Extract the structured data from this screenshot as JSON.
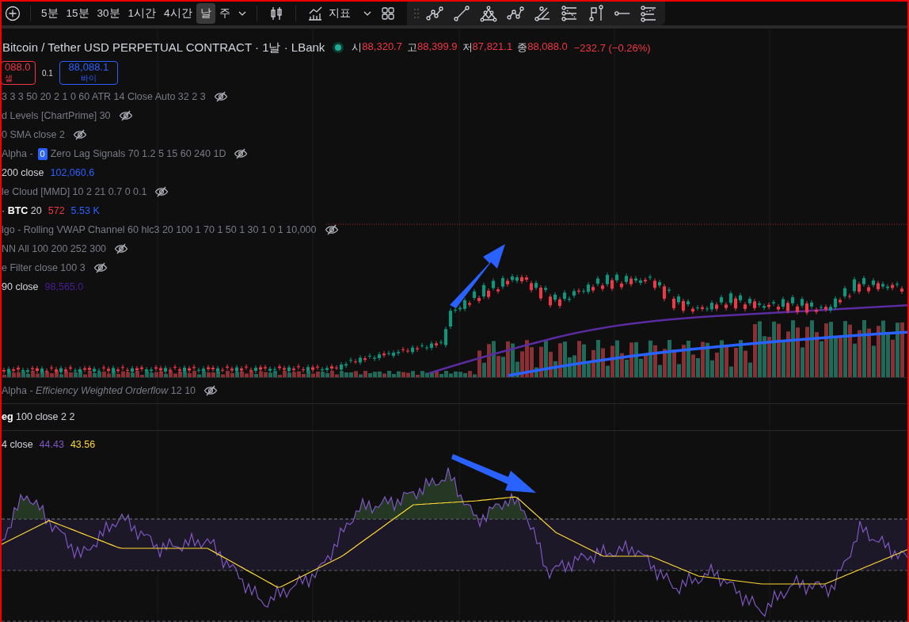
{
  "toolbar": {
    "intervals": [
      {
        "label": "5분",
        "selected": false
      },
      {
        "label": "15분",
        "selected": false
      },
      {
        "label": "30분",
        "selected": false
      },
      {
        "label": "1시간",
        "selected": false
      },
      {
        "label": "4시간",
        "selected": false
      },
      {
        "label": "날",
        "selected": true
      },
      {
        "label": "주",
        "selected": false
      }
    ],
    "indicators_label": "지표"
  },
  "header": {
    "title": "Bitcoin / Tether USD PERPETUAL CONTRACT · 1날 · LBank",
    "market_open": true,
    "ohlc": [
      {
        "label": "시",
        "value": "88,320.7"
      },
      {
        "label": "고",
        "value": "88,399.9"
      },
      {
        "label": "저",
        "value": "87,821.1"
      },
      {
        "label": "종",
        "value": "88,088.0"
      }
    ],
    "change": "−232.7 (−0.26%)"
  },
  "trade": {
    "sell_price": "088.0",
    "sell_label": "셀",
    "quantity": "0.1",
    "buy_price": "88,088.1",
    "buy_label": "바이"
  },
  "legend": [
    {
      "parts": [
        {
          "kind": "text",
          "text": "3 3 3 50 20 2 1 0 60 ATR 14 Close Auto 32 2 3"
        }
      ],
      "hidden": true
    },
    {
      "parts": [
        {
          "kind": "text",
          "text": "d Levels [ChartPrime] 30"
        }
      ],
      "hidden": true
    },
    {
      "parts": [
        {
          "kind": "text",
          "text": "0 SMA close 2"
        }
      ],
      "hidden": true
    },
    {
      "parts": [
        {
          "kind": "text",
          "text": "Alpha -"
        },
        {
          "kind": "badge",
          "text": "0"
        },
        {
          "kind": "text",
          "text": "Zero Lag Signals 70 1.2 5 15 60 240 1D"
        }
      ],
      "hidden": true
    },
    {
      "parts": [
        {
          "kind": "text",
          "text": "200 close"
        }
      ],
      "hidden": false,
      "values": [
        {
          "text": "102,060.6",
          "color": "#2962ff"
        }
      ]
    },
    {
      "parts": [
        {
          "kind": "text",
          "text": "le Cloud [MMD] 10 2 21 0.7 0 0.1"
        }
      ],
      "hidden": true
    },
    {
      "parts": [
        {
          "kind": "text",
          "text": "· **BTC** 20"
        }
      ],
      "hidden": false,
      "values": [
        {
          "text": "572",
          "color": "#f23645"
        },
        {
          "text": "5.53 K",
          "color": "#2962ff"
        }
      ]
    },
    {
      "parts": [
        {
          "kind": "text",
          "text": "lgo - Rolling VWAP Channel 60 hlc3 20 100 1 70 1 50 1 30 1 0 1 10,000"
        }
      ],
      "hidden": true
    },
    {
      "parts": [
        {
          "kind": "text",
          "text": "NN All 100 200 252 300"
        }
      ],
      "hidden": true
    },
    {
      "parts": [
        {
          "kind": "text",
          "text": "e Filter close 100 3"
        }
      ],
      "hidden": true
    },
    {
      "parts": [
        {
          "kind": "text",
          "text": "90 close"
        }
      ],
      "hidden": false,
      "values": [
        {
          "text": "98,565.0",
          "color": "#4a1d96"
        }
      ]
    }
  ],
  "panes": [
    {
      "legend": {
        "text": "Alpha - *Efficiency Weighted Orderflow* 12 10",
        "hidden": true
      }
    },
    {
      "legend": {
        "text": "**eg** 100 close 2 2",
        "hidden": false
      }
    },
    {
      "legend": {
        "text": "4 close",
        "hidden": false,
        "values": [
          {
            "text": "44.43",
            "color": "#7e57c2"
          },
          {
            "text": "43.56",
            "color": "#fdd835"
          }
        ]
      }
    }
  ]
}
